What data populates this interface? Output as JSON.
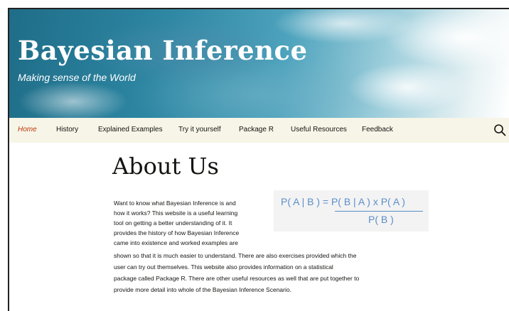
{
  "header": {
    "site_title": "Bayesian Inference",
    "tagline": "Making sense of the World"
  },
  "nav": {
    "items": [
      {
        "label": "Home",
        "active": true
      },
      {
        "label": "History"
      },
      {
        "label": "Explained Examples"
      },
      {
        "label": "Try it yourself"
      },
      {
        "label": "Package R"
      },
      {
        "label": "Useful Resources"
      },
      {
        "label": "Feedback"
      }
    ],
    "search_icon": "search-icon"
  },
  "main": {
    "title": "About Us",
    "paragraph_lines": [
      "Want to know what Bayesian Inference is and",
      "how it works? This website is a useful learning",
      "tool on getting a better understanding of it. It",
      "provides the history of how Bayesian Inference",
      "came into existence and worked examples are",
      "shown so that it is much easier to understand. There are also exercises provided which the",
      "user can try out themselves. This website also provides information on a statistical",
      "package called Package R. There are other useful resources as well that are put together to",
      "provide more detail into whole of the Bayesian Inference Scenario."
    ],
    "formula": {
      "lhs_numerator": "P( A | B ) = P( B | A )  x  P( A )",
      "denominator": "P( B )"
    }
  },
  "colors": {
    "nav_active": "#bc360a",
    "nav_bg": "#f7f5e7",
    "formula": "#5b8ec9"
  }
}
